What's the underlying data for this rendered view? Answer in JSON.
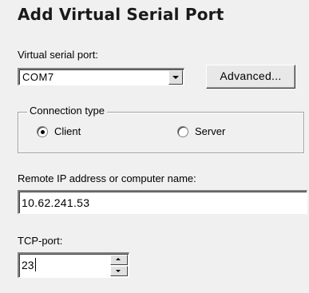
{
  "dialog": {
    "title": "Add Virtual Serial Port"
  },
  "port": {
    "label": "Virtual serial port:",
    "selected": "COM7",
    "dropdown_icon": "chevron-down-icon"
  },
  "advanced_button": {
    "label": "Advanced..."
  },
  "connection": {
    "legend": "Connection type",
    "options": [
      {
        "label": "Client",
        "checked": true
      },
      {
        "label": "Server",
        "checked": false
      }
    ]
  },
  "remote": {
    "label": "Remote IP address or computer name:",
    "value": "10.62.241.53"
  },
  "tcp": {
    "label": "TCP-port:",
    "value": "23"
  }
}
